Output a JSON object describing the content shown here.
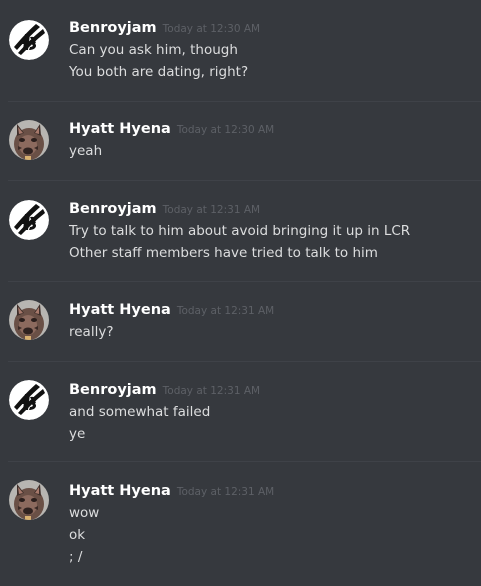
{
  "colors": {
    "background": "#36393e",
    "divider": "#3f4248",
    "username": "#ffffff",
    "timestamp": "#5d6066",
    "message_text": "#dcddde"
  },
  "messages": [
    {
      "author": "Benroyjam",
      "avatar_icon": "benroyjam-logo-avatar-icon",
      "timestamp": "Today at 12:30 AM",
      "lines": [
        "Can you ask him, though",
        "You both are dating, right?"
      ]
    },
    {
      "author": "Hyatt Hyena",
      "avatar_icon": "hyena-avatar-icon",
      "timestamp": "Today at 12:30 AM",
      "lines": [
        "yeah"
      ]
    },
    {
      "author": "Benroyjam",
      "avatar_icon": "benroyjam-logo-avatar-icon",
      "timestamp": "Today at 12:31 AM",
      "lines": [
        "Try to talk to him about avoid bringing it up in LCR",
        "Other staff members have tried to talk to him"
      ]
    },
    {
      "author": "Hyatt Hyena",
      "avatar_icon": "hyena-avatar-icon",
      "timestamp": "Today at 12:31 AM",
      "lines": [
        "really?"
      ]
    },
    {
      "author": "Benroyjam",
      "avatar_icon": "benroyjam-logo-avatar-icon",
      "timestamp": "Today at 12:31 AM",
      "lines": [
        "and somewhat failed",
        "ye"
      ]
    },
    {
      "author": "Hyatt Hyena",
      "avatar_icon": "hyena-avatar-icon",
      "timestamp": "Today at 12:31 AM",
      "lines": [
        "wow",
        "ok",
        "; /"
      ]
    }
  ]
}
